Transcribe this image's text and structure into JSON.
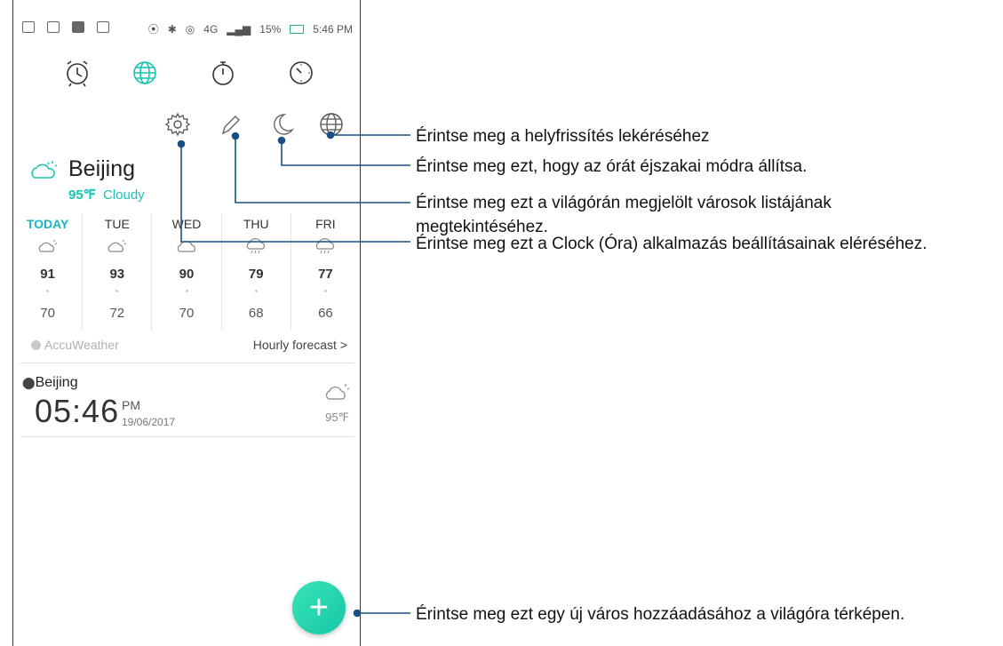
{
  "status_bar": {
    "battery": "15%",
    "time": "5:46 PM",
    "network": "4G"
  },
  "tabs": [
    {
      "name": "Alarm",
      "icon": "alarm-clock-icon"
    },
    {
      "name": "World clock",
      "icon": "globe-icon"
    },
    {
      "name": "Stopwatch",
      "icon": "stopwatch-icon"
    },
    {
      "name": "Timer",
      "icon": "timer-icon"
    }
  ],
  "weather": {
    "city": "Beijing",
    "temp": "95℉",
    "condition": "Cloudy",
    "forecast": [
      {
        "day": "TODAY",
        "hi": "91",
        "lo": "70"
      },
      {
        "day": "TUE",
        "hi": "93",
        "lo": "72"
      },
      {
        "day": "WED",
        "hi": "90",
        "lo": "70"
      },
      {
        "day": "THU",
        "hi": "79",
        "lo": "68"
      },
      {
        "day": "FRI",
        "hi": "77",
        "lo": "66"
      }
    ],
    "source": "AccuWeather",
    "hourly": "Hourly forecast >"
  },
  "clock_card": {
    "city": "Beijing",
    "time": "05:46",
    "ampm": "PM",
    "date": "19/06/2017",
    "temp": "95℉"
  },
  "callouts": {
    "globe": "Érintse meg a helyfrissítés lekéréséhez",
    "night": "Érintse meg ezt, hogy az órát éjszakai módra állítsa.",
    "edit_line1": "Érintse meg ezt a világórán megjelölt városok listájának",
    "edit_line2": "megtekintéséhez.",
    "settings": "Érintse meg ezt a Clock (Óra) alkalmazás beállításainak eléréséhez.",
    "add": "Érintse meg ezt egy új város hozzáadásához a világóra térképen."
  },
  "colors": {
    "accent": "#17c3b2",
    "fab": "#2fd9b3"
  }
}
